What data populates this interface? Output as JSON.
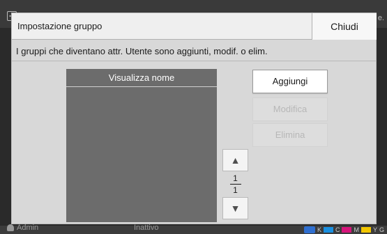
{
  "background": {
    "top_right_text": "e.",
    "user_label": "Admin",
    "status_text": "Inattivo",
    "ink": {
      "labels": [
        "K",
        "C",
        "M",
        "Y",
        "G"
      ],
      "colors": {
        "K": "#222222",
        "C": "#1a8fe0",
        "M": "#d6147a",
        "Y": "#f2c600",
        "G": "#8a8a8a"
      }
    }
  },
  "dialog": {
    "title": "Impostazione gruppo",
    "close_label": "Chiudi",
    "description": "I gruppi che diventano attr. Utente sono aggiunti, modif. o elim.",
    "list": {
      "header": "Visualizza nome",
      "items": []
    },
    "buttons": {
      "add": "Aggiungi",
      "edit": "Modifica",
      "delete": "Elimina"
    },
    "pager": {
      "current": "1",
      "total": "1",
      "up_icon": "triangle-up-icon",
      "down_icon": "triangle-down-icon"
    }
  }
}
